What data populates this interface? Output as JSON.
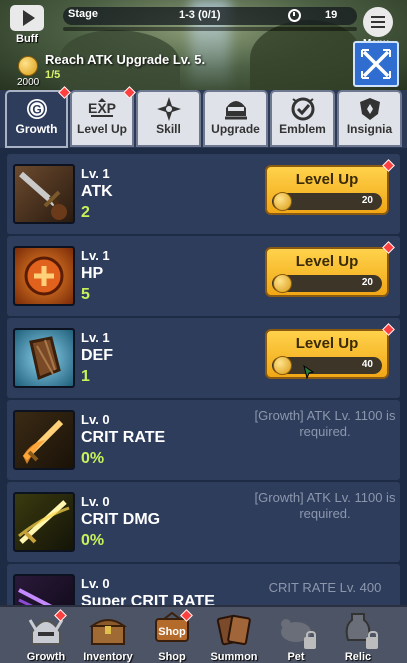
{
  "header": {
    "buff_label": "Buff",
    "stage_label": "Stage",
    "stage_value": "1-3 (0/1)",
    "timer_value": "19",
    "menu_label": "Menu",
    "quest_text": "Reach ATK Upgrade Lv. 5.",
    "quest_progress": "1/5",
    "quest_reward": "2000"
  },
  "tabs": [
    {
      "label": "Growth",
      "icon": "growth-g-icon",
      "active": true,
      "badge": true
    },
    {
      "label": "Level Up",
      "icon": "exp-icon",
      "active": false,
      "badge": true
    },
    {
      "label": "Skill",
      "icon": "skill-shuriken-icon",
      "active": false,
      "badge": false
    },
    {
      "label": "Upgrade",
      "icon": "ninja-helmet-icon",
      "active": false,
      "badge": false
    },
    {
      "label": "Emblem",
      "icon": "emblem-check-icon",
      "active": false,
      "badge": false
    },
    {
      "label": "Insignia",
      "icon": "insignia-shield-icon",
      "active": false,
      "badge": false
    }
  ],
  "stats": [
    {
      "level": "Lv. 1",
      "name": "ATK",
      "value": "2",
      "button_label": "Level Up",
      "cost": "20",
      "icon": "sword-icon"
    },
    {
      "level": "Lv. 1",
      "name": "HP",
      "value": "5",
      "button_label": "Level Up",
      "cost": "20",
      "icon": "health-orb-icon"
    },
    {
      "level": "Lv. 1",
      "name": "DEF",
      "value": "1",
      "button_label": "Level Up",
      "cost": "40",
      "icon": "shield-icon"
    },
    {
      "level": "Lv. 0",
      "name": "CRIT RATE",
      "value": "0%",
      "requirement": "[Growth] ATK Lv. 1100 is required.",
      "icon": "flaming-sword-icon"
    },
    {
      "level": "Lv. 0",
      "name": "CRIT DMG",
      "value": "0%",
      "requirement": "[Growth] ATK Lv. 1100 is required.",
      "icon": "glowing-sword-icon"
    },
    {
      "level": "Lv. 0",
      "name": "Super CRIT RATE",
      "requirement": "CRIT RATE Lv. 400",
      "icon": "purple-slash-icon"
    }
  ],
  "bottom_nav": [
    {
      "label": "Growth",
      "icon": "helmet-icon",
      "badge": true,
      "locked": false
    },
    {
      "label": "Inventory",
      "icon": "chest-icon",
      "badge": false,
      "locked": false
    },
    {
      "label": "Shop",
      "icon": "shop-sign-icon",
      "badge": true,
      "locked": false
    },
    {
      "label": "Summon",
      "icon": "cards-icon",
      "badge": false,
      "locked": false
    },
    {
      "label": "Pet",
      "icon": "pet-icon",
      "badge": false,
      "locked": true
    },
    {
      "label": "Relic",
      "icon": "relic-urn-icon",
      "badge": false,
      "locked": true
    }
  ],
  "colors": {
    "accent_gold": "#f1a716",
    "value_green": "#c7f25a",
    "panel": "#2f3d5d",
    "badge_red": "#ff4040"
  }
}
